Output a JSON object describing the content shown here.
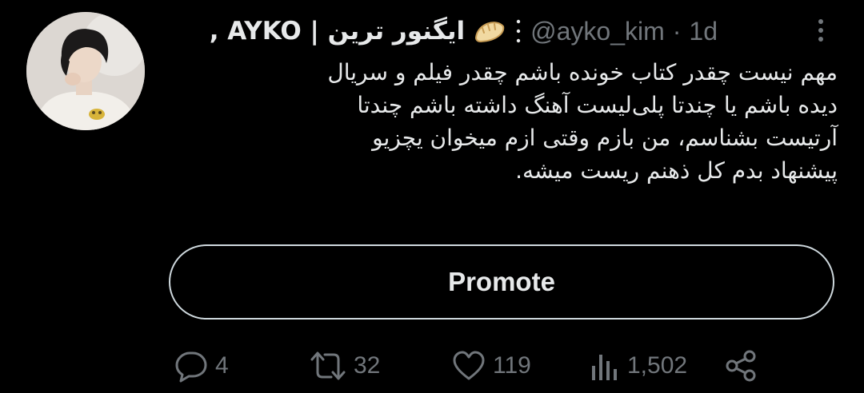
{
  "tweet": {
    "author": {
      "display_name": ", AYKO | ایگنور ترین",
      "handle": "@ayko_kim",
      "separator": "·",
      "time": "1d",
      "emoji": "🥟",
      "avatar_icon": "user-photo-avatar"
    },
    "text_lines": [
      "مهم نیست چقدر کتاب خونده باشم چقدر فیلم و سریال",
      "دیده باشم یا چندتا پلی‌لیست آهنگ داشته باشم چندتا",
      "آرتیست بشناسم، من بازم وقتی ازم میخوان یچزیو",
      "پیشنهاد بدم کل ذهنم ریست میشه."
    ],
    "promote_label": "Promote",
    "actions": {
      "reply": {
        "icon": "reply-icon",
        "count": "4"
      },
      "retweet": {
        "icon": "retweet-icon",
        "count": "32"
      },
      "like": {
        "icon": "heart-icon",
        "count": "119"
      },
      "views": {
        "icon": "views-chart-icon",
        "count": "1,502"
      },
      "share": {
        "icon": "share-icon"
      }
    },
    "more_icon": "more-options-icon"
  },
  "colors": {
    "background": "#000000",
    "primary_text": "#e7e9ea",
    "secondary_text": "#71767b",
    "button_border": "#cfd9de"
  }
}
